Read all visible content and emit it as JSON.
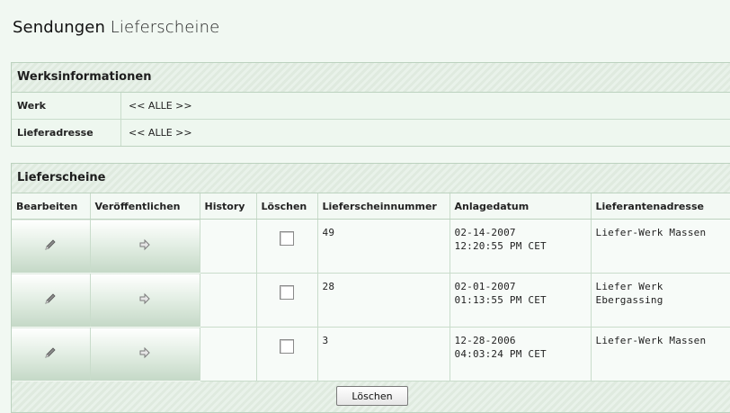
{
  "page": {
    "title_strong": "Sendungen",
    "title_sub": "Lieferscheine"
  },
  "werks": {
    "header": "Werksinformationen",
    "rows": [
      {
        "label": "Werk",
        "value": "<< ALLE >>"
      },
      {
        "label": "Lieferadresse",
        "value": "<< ALLE >>"
      }
    ]
  },
  "lieferscheine": {
    "header": "Lieferscheine",
    "columns": [
      "Bearbeiten",
      "Veröffentlichen",
      "History",
      "Löschen",
      "Lieferscheinnummer",
      "Anlagedatum",
      "Lieferantenadresse"
    ],
    "rows": [
      {
        "edit_icon": "pencil-icon",
        "publish_icon": "arrow-right-icon",
        "history": "",
        "nummer": "49",
        "datum_line1": "02-14-2007",
        "datum_line2": "12:20:55 PM CET",
        "adresse_line1": "Liefer-Werk Massen",
        "adresse_line2": ""
      },
      {
        "edit_icon": "pencil-icon",
        "publish_icon": "arrow-right-icon",
        "history": "",
        "nummer": "28",
        "datum_line1": "02-01-2007",
        "datum_line2": "01:13:55 PM CET",
        "adresse_line1": "Liefer Werk",
        "adresse_line2": "Ebergassing"
      },
      {
        "edit_icon": "pencil-icon",
        "publish_icon": "arrow-right-icon",
        "history": "",
        "nummer": "3",
        "datum_line1": "12-28-2006",
        "datum_line2": "04:03:24 PM CET",
        "adresse_line1": "Liefer-Werk Massen",
        "adresse_line2": ""
      }
    ],
    "delete_button": "Löschen"
  },
  "colors": {
    "background": "#f1f8f2",
    "border": "#bcd2bf",
    "header_stripe": "#dfeadf"
  }
}
